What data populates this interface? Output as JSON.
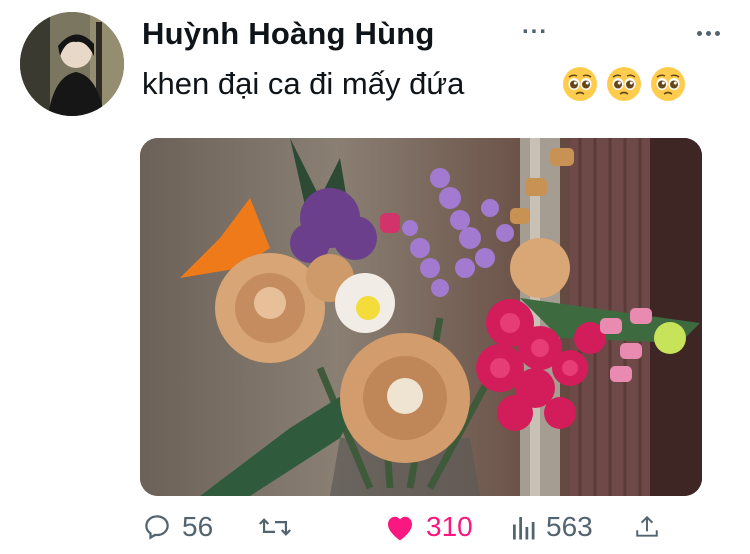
{
  "tweet": {
    "author_name": "Huỳnh Hoàng Hùng",
    "truncation": "...",
    "text": "khen đại ca đi mấy đứa",
    "emoji_count": 3,
    "emoji_icon": "pleading-face-icon"
  },
  "metrics": {
    "replies": "56",
    "likes": "310",
    "views": "563"
  },
  "icons": {
    "reply": "reply-icon",
    "retweet": "retweet-icon",
    "like": "heart-icon",
    "views": "views-icon",
    "share": "share-icon",
    "more": "more-icon"
  },
  "colors": {
    "text": "#0f1419",
    "secondary": "#536471",
    "like_active": "#f91880"
  }
}
